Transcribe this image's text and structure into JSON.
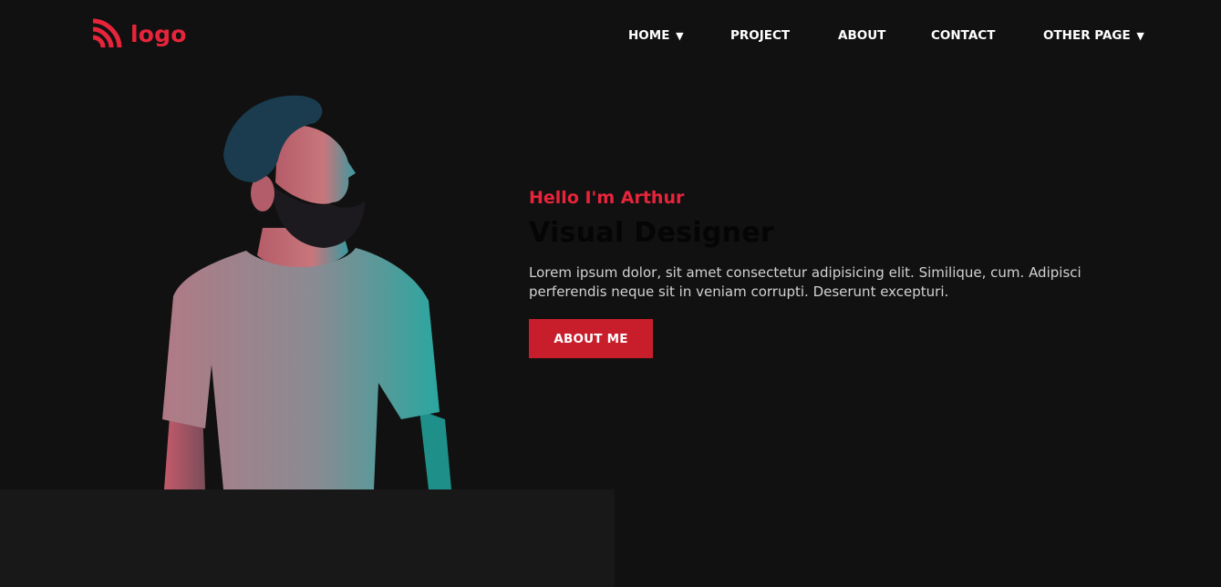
{
  "header": {
    "logo_text": "logo",
    "logo_icon": "wifi-signal-icon",
    "nav": [
      {
        "label": "HOME",
        "caret": "▼"
      },
      {
        "label": "PROJECT"
      },
      {
        "label": "ABOUT"
      },
      {
        "label": "CONTACT"
      },
      {
        "label": "OTHER PAGE",
        "caret": "▼"
      }
    ]
  },
  "hero": {
    "greeting": "Hello I'm Arthur",
    "headline": "Visual Designer",
    "description": "Lorem ipsum dolor, sit amet consectetur adipisicing elit. Similique, cum. Adipisci perferendis neque sit in veniam corrupti. Deserunt excepturi.",
    "cta_label": "ABOUT ME",
    "image": "portrait-man-beard"
  },
  "colors": {
    "background": "#111111",
    "accent": "#e8243b",
    "button": "#c81e2c",
    "panel": "#181818",
    "text": "#d2d2d2"
  }
}
